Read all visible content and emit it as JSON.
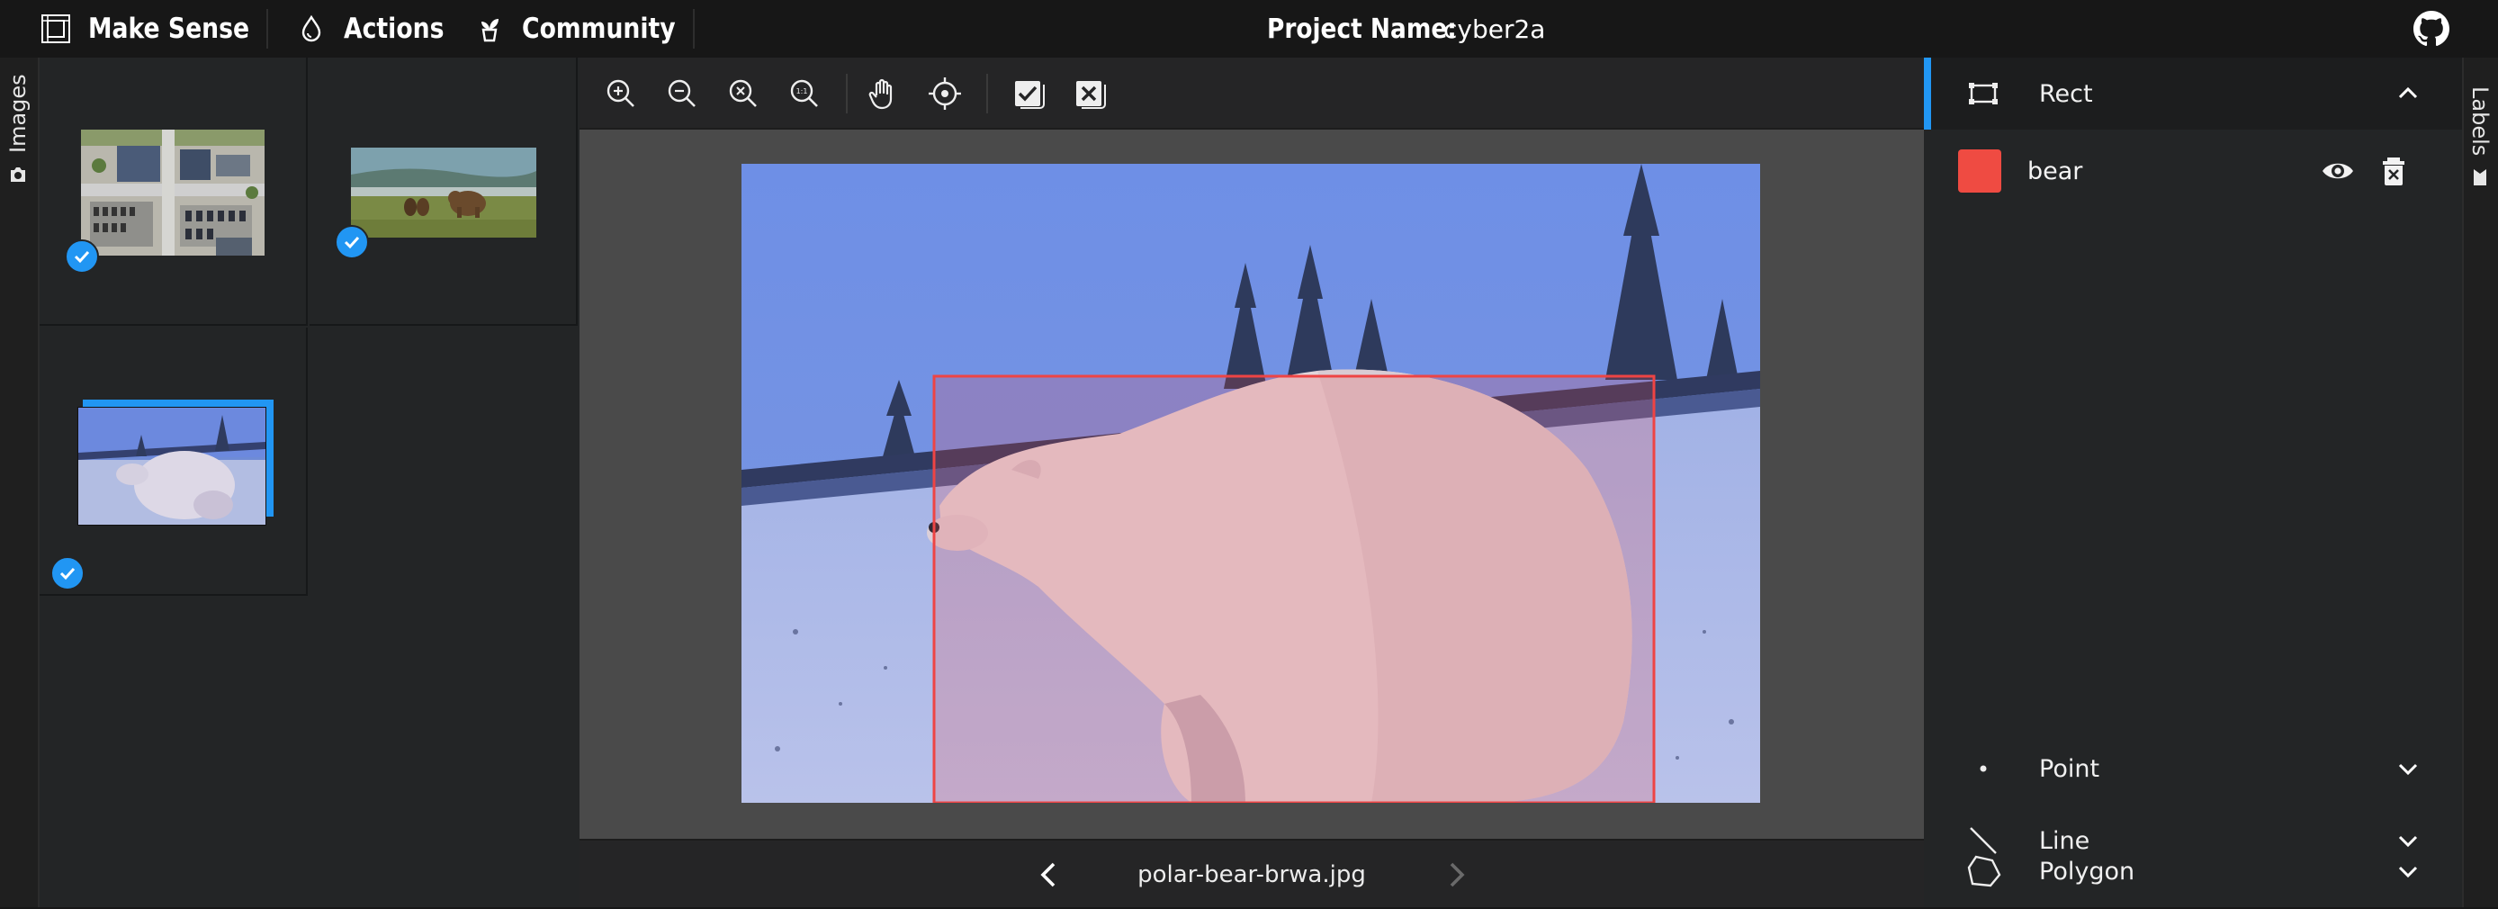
{
  "app": {
    "name": "Make Sense",
    "nav": [
      {
        "label": "Actions",
        "icon": "drop-icon"
      },
      {
        "label": "Community",
        "icon": "community-icon"
      }
    ],
    "project_label": "Project Name:",
    "project_value": "cyber2a"
  },
  "side_tabs": {
    "left": "Images",
    "right": "Labels"
  },
  "images": [
    {
      "name": "aerial-parking-lot",
      "checked": true,
      "selected": false
    },
    {
      "name": "brown-bears-meadow",
      "checked": true,
      "selected": false
    },
    {
      "name": "polar-bear-brwa.jpg",
      "checked": true,
      "selected": true
    }
  ],
  "editor": {
    "tools": [
      "zoom-in-icon",
      "zoom-out-icon",
      "zoom-fit-icon",
      "zoom-actual-icon",
      "pan-hand-icon",
      "crosshair-icon",
      "accept-labels-icon",
      "reject-labels-icon"
    ],
    "filename": "polar-bear-brwa.jpg",
    "annotation": {
      "label": "bear",
      "color": "#ee4444"
    }
  },
  "labels_panel": {
    "active_tool": "Rect",
    "labels": [
      {
        "name": "bear",
        "color": "#ef4b42"
      }
    ],
    "tools": [
      "Point",
      "Line",
      "Polygon"
    ]
  },
  "colors": {
    "accent": "#2196f3",
    "topbar": "#171717",
    "panel": "#232526",
    "editor_bg": "#4a4a4a"
  }
}
